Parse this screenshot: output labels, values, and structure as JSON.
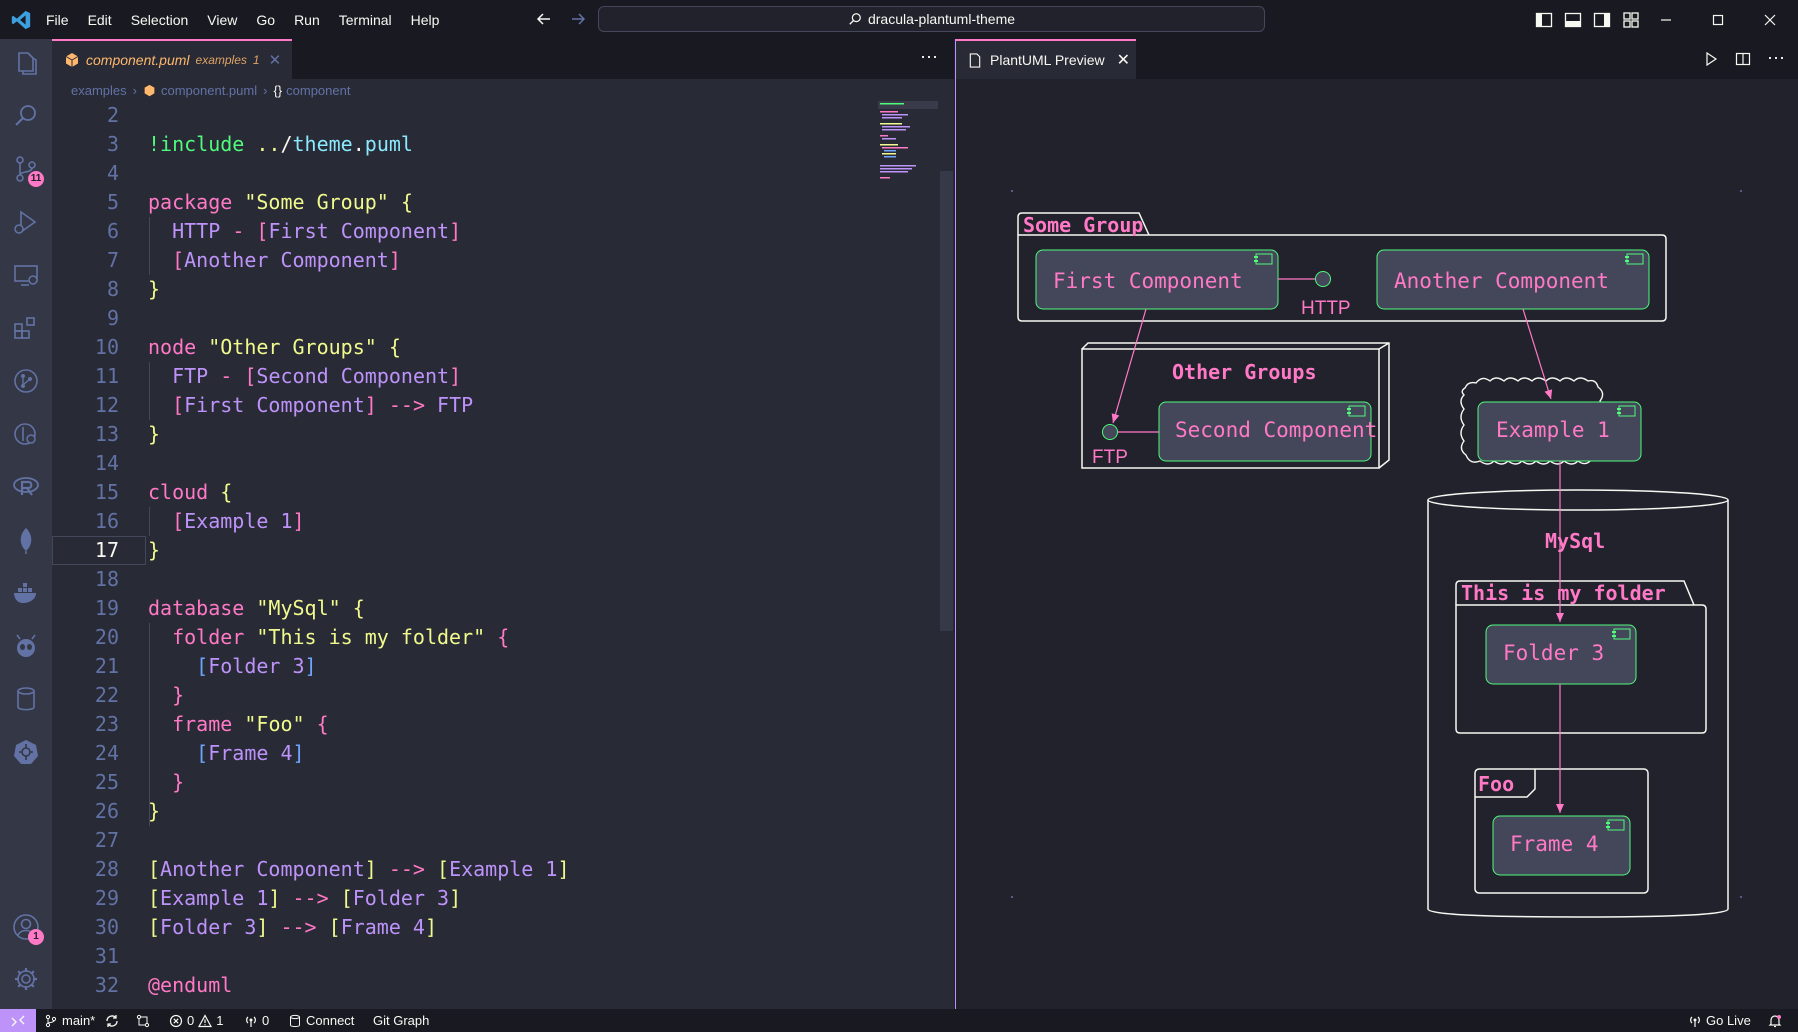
{
  "menu": [
    "File",
    "Edit",
    "Selection",
    "View",
    "Go",
    "Run",
    "Terminal",
    "Help"
  ],
  "command_center": {
    "text": "dracula-plantuml-theme"
  },
  "activity_bar": {
    "source_control_badge": "11",
    "accounts_badge": "1"
  },
  "editor": {
    "tab": {
      "filename": "component.puml",
      "folder": "examples",
      "problems": "1"
    },
    "breadcrumb": {
      "folder": "examples",
      "file": "component.puml",
      "symbol": "component"
    },
    "lines": [
      {
        "n": "2",
        "tokens": []
      },
      {
        "n": "3",
        "tokens": [
          {
            "t": "!include",
            "c": "g"
          },
          {
            "t": " ",
            "c": ""
          },
          {
            "t": "..",
            "c": "s"
          },
          {
            "t": "/",
            "c": ""
          },
          {
            "t": "theme",
            "c": "c"
          },
          {
            "t": ".",
            "c": ""
          },
          {
            "t": "puml",
            "c": "c"
          }
        ]
      },
      {
        "n": "4",
        "tokens": []
      },
      {
        "n": "5",
        "tokens": [
          {
            "t": "package",
            "c": "k"
          },
          {
            "t": " ",
            "c": ""
          },
          {
            "t": "\"Some Group\"",
            "c": "s"
          },
          {
            "t": " ",
            "c": ""
          },
          {
            "t": "{",
            "c": "y"
          }
        ]
      },
      {
        "n": "6",
        "tokens": [
          {
            "t": "  ",
            "c": ""
          },
          {
            "t": "HTTP",
            "c": "p"
          },
          {
            "t": " ",
            "c": ""
          },
          {
            "t": "-",
            "c": "k"
          },
          {
            "t": " ",
            "c": ""
          },
          {
            "t": "[",
            "c": "pk"
          },
          {
            "t": "First Component",
            "c": "p"
          },
          {
            "t": "]",
            "c": "pk"
          }
        ]
      },
      {
        "n": "7",
        "tokens": [
          {
            "t": "  ",
            "c": ""
          },
          {
            "t": "[",
            "c": "pk"
          },
          {
            "t": "Another Component",
            "c": "p"
          },
          {
            "t": "]",
            "c": "pk"
          }
        ]
      },
      {
        "n": "8",
        "tokens": [
          {
            "t": "}",
            "c": "y"
          }
        ]
      },
      {
        "n": "9",
        "tokens": []
      },
      {
        "n": "10",
        "tokens": [
          {
            "t": "node",
            "c": "k"
          },
          {
            "t": " ",
            "c": ""
          },
          {
            "t": "\"Other Groups\"",
            "c": "s"
          },
          {
            "t": " ",
            "c": ""
          },
          {
            "t": "{",
            "c": "y"
          }
        ]
      },
      {
        "n": "11",
        "tokens": [
          {
            "t": "  ",
            "c": ""
          },
          {
            "t": "FTP",
            "c": "p"
          },
          {
            "t": " ",
            "c": ""
          },
          {
            "t": "-",
            "c": "k"
          },
          {
            "t": " ",
            "c": ""
          },
          {
            "t": "[",
            "c": "pk"
          },
          {
            "t": "Second Component",
            "c": "p"
          },
          {
            "t": "]",
            "c": "pk"
          }
        ]
      },
      {
        "n": "12",
        "tokens": [
          {
            "t": "  ",
            "c": ""
          },
          {
            "t": "[",
            "c": "pk"
          },
          {
            "t": "First Component",
            "c": "p"
          },
          {
            "t": "]",
            "c": "pk"
          },
          {
            "t": " ",
            "c": ""
          },
          {
            "t": "-->",
            "c": "k"
          },
          {
            "t": " ",
            "c": ""
          },
          {
            "t": "FTP",
            "c": "p"
          }
        ]
      },
      {
        "n": "13",
        "tokens": [
          {
            "t": "}",
            "c": "y"
          }
        ]
      },
      {
        "n": "14",
        "tokens": []
      },
      {
        "n": "15",
        "tokens": [
          {
            "t": "cloud",
            "c": "k"
          },
          {
            "t": " ",
            "c": ""
          },
          {
            "t": "{",
            "c": "y"
          }
        ]
      },
      {
        "n": "16",
        "tokens": [
          {
            "t": "  ",
            "c": ""
          },
          {
            "t": "[",
            "c": "pk"
          },
          {
            "t": "Example 1",
            "c": "p"
          },
          {
            "t": "]",
            "c": "pk"
          }
        ]
      },
      {
        "n": "17",
        "tokens": [
          {
            "t": "}",
            "c": "y"
          }
        ],
        "active": true
      },
      {
        "n": "18",
        "tokens": []
      },
      {
        "n": "19",
        "tokens": [
          {
            "t": "database",
            "c": "k"
          },
          {
            "t": " ",
            "c": ""
          },
          {
            "t": "\"MySql\"",
            "c": "s"
          },
          {
            "t": " ",
            "c": ""
          },
          {
            "t": "{",
            "c": "y"
          }
        ]
      },
      {
        "n": "20",
        "tokens": [
          {
            "t": "  ",
            "c": ""
          },
          {
            "t": "folder",
            "c": "k"
          },
          {
            "t": " ",
            "c": ""
          },
          {
            "t": "\"This is my folder\"",
            "c": "s"
          },
          {
            "t": " ",
            "c": ""
          },
          {
            "t": "{",
            "c": "pk"
          }
        ]
      },
      {
        "n": "21",
        "tokens": [
          {
            "t": "    ",
            "c": ""
          },
          {
            "t": "[",
            "c": "bl"
          },
          {
            "t": "Folder 3",
            "c": "p"
          },
          {
            "t": "]",
            "c": "bl"
          }
        ]
      },
      {
        "n": "22",
        "tokens": [
          {
            "t": "  ",
            "c": ""
          },
          {
            "t": "}",
            "c": "pk"
          }
        ]
      },
      {
        "n": "23",
        "tokens": [
          {
            "t": "  ",
            "c": ""
          },
          {
            "t": "frame",
            "c": "k"
          },
          {
            "t": " ",
            "c": ""
          },
          {
            "t": "\"Foo\"",
            "c": "s"
          },
          {
            "t": " ",
            "c": ""
          },
          {
            "t": "{",
            "c": "pk"
          }
        ]
      },
      {
        "n": "24",
        "tokens": [
          {
            "t": "    ",
            "c": ""
          },
          {
            "t": "[",
            "c": "bl"
          },
          {
            "t": "Frame 4",
            "c": "p"
          },
          {
            "t": "]",
            "c": "bl"
          }
        ]
      },
      {
        "n": "25",
        "tokens": [
          {
            "t": "  ",
            "c": ""
          },
          {
            "t": "}",
            "c": "pk"
          }
        ]
      },
      {
        "n": "26",
        "tokens": [
          {
            "t": "}",
            "c": "y"
          }
        ]
      },
      {
        "n": "27",
        "tokens": []
      },
      {
        "n": "28",
        "tokens": [
          {
            "t": "[",
            "c": "y"
          },
          {
            "t": "Another Component",
            "c": "p"
          },
          {
            "t": "]",
            "c": "y"
          },
          {
            "t": " ",
            "c": ""
          },
          {
            "t": "-->",
            "c": "k"
          },
          {
            "t": " ",
            "c": ""
          },
          {
            "t": "[",
            "c": "y"
          },
          {
            "t": "Example 1",
            "c": "p"
          },
          {
            "t": "]",
            "c": "y"
          }
        ]
      },
      {
        "n": "29",
        "tokens": [
          {
            "t": "[",
            "c": "y"
          },
          {
            "t": "Example 1",
            "c": "p"
          },
          {
            "t": "]",
            "c": "y"
          },
          {
            "t": " ",
            "c": ""
          },
          {
            "t": "-->",
            "c": "k"
          },
          {
            "t": " ",
            "c": ""
          },
          {
            "t": "[",
            "c": "y"
          },
          {
            "t": "Folder 3",
            "c": "p"
          },
          {
            "t": "]",
            "c": "y"
          }
        ]
      },
      {
        "n": "30",
        "tokens": [
          {
            "t": "[",
            "c": "y"
          },
          {
            "t": "Folder 3",
            "c": "p"
          },
          {
            "t": "]",
            "c": "y"
          },
          {
            "t": " ",
            "c": ""
          },
          {
            "t": "-->",
            "c": "k"
          },
          {
            "t": " ",
            "c": ""
          },
          {
            "t": "[",
            "c": "y"
          },
          {
            "t": "Frame 4",
            "c": "p"
          },
          {
            "t": "]",
            "c": "y"
          }
        ]
      },
      {
        "n": "31",
        "tokens": []
      },
      {
        "n": "32",
        "tokens": [
          {
            "t": "@enduml",
            "c": "k"
          }
        ]
      }
    ]
  },
  "preview": {
    "tab_title": "PlantUML Preview",
    "diagram": {
      "package_title": "Some Group",
      "first_component": "First Component",
      "another_component": "Another Component",
      "http_label": "HTTP",
      "node_title": "Other Groups",
      "second_component": "Second Component",
      "ftp_label": "FTP",
      "example1": "Example 1",
      "database_title": "MySql",
      "folder_title": "This is my folder",
      "folder3": "Folder 3",
      "frame_title": "Foo",
      "frame4": "Frame 4"
    }
  },
  "status_bar": {
    "branch": "main*",
    "errors": "0",
    "warnings": "1",
    "ports": "0",
    "connect": "Connect",
    "git_graph": "Git Graph",
    "go_live": "Go Live"
  },
  "colors": {
    "background": "#282a36",
    "current_line": "#44475a",
    "foreground": "#f8f8f2",
    "comment": "#6272a4",
    "cyan": "#8be9fd",
    "green": "#50fa7b",
    "orange": "#ffb86c",
    "pink": "#ff79c6",
    "purple": "#bd93f9",
    "yellow": "#f1fa8c"
  }
}
